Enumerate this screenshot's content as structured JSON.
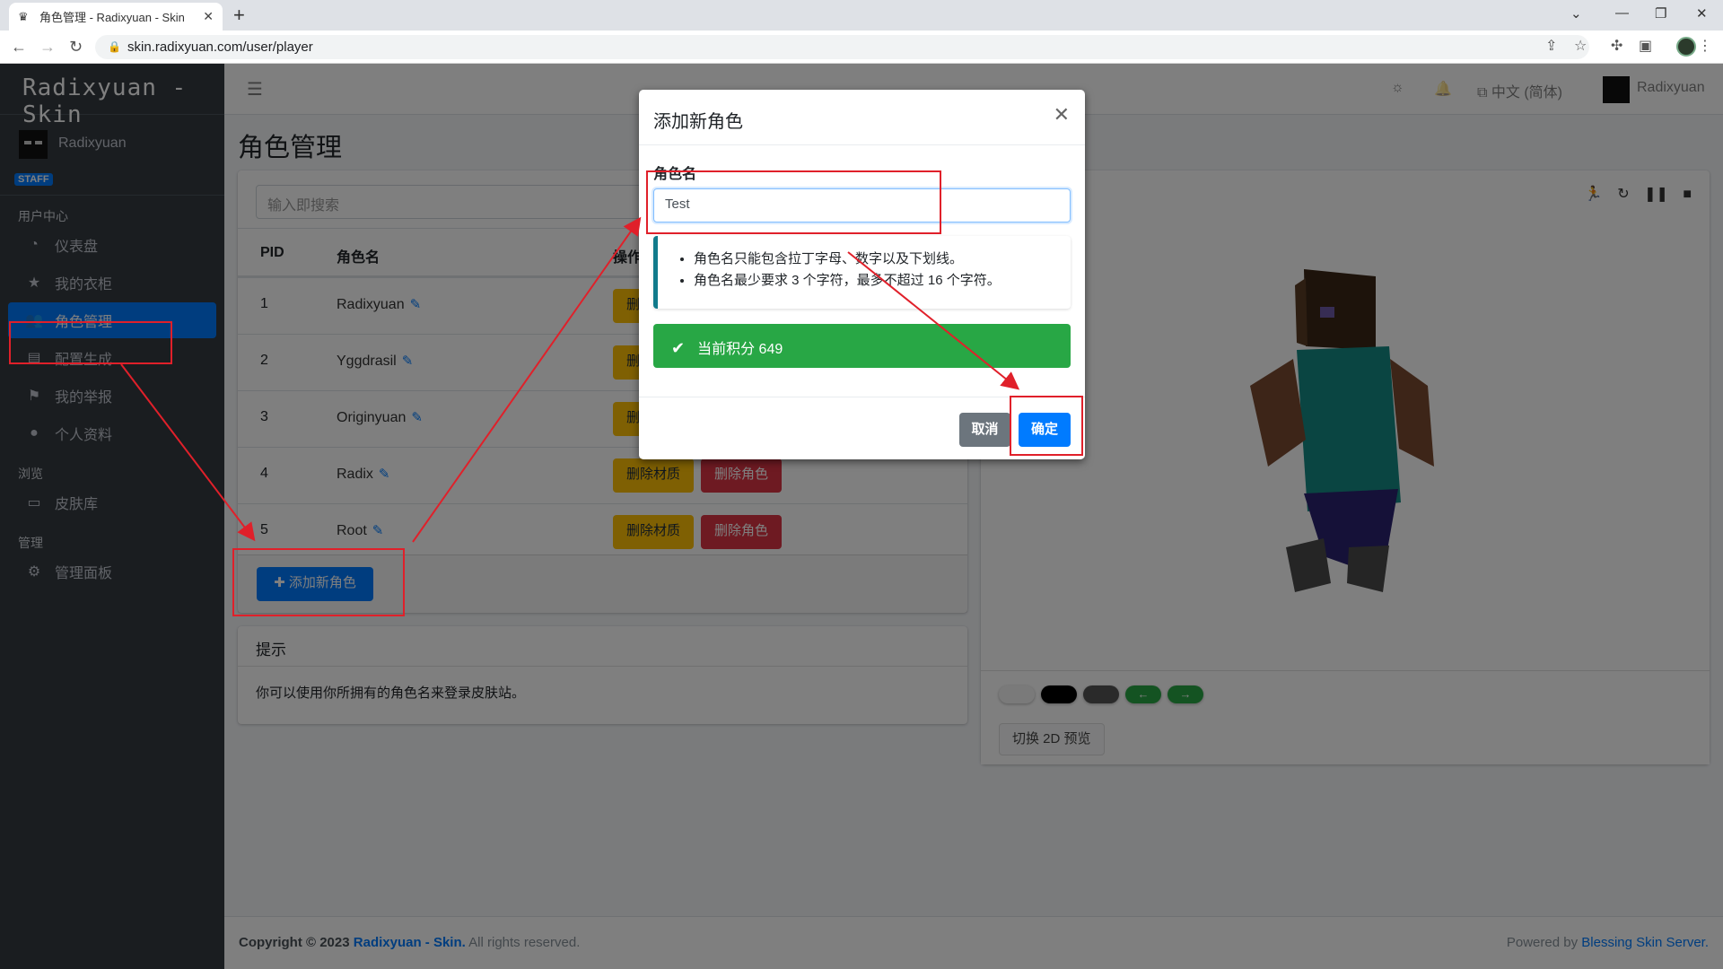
{
  "browser": {
    "tab_title": "角色管理 - Radixyuan - Skin",
    "url": "skin.radixyuan.com/user/player"
  },
  "sidebar": {
    "brand": "Radixyuan - Skin",
    "user_name": "Radixyuan",
    "badge": "STAFF",
    "sections": [
      {
        "header": "用户中心"
      },
      {
        "header": "浏览"
      },
      {
        "header": "管理"
      }
    ],
    "items": [
      {
        "label": "仪表盘",
        "icon": "dashboard-icon"
      },
      {
        "label": "我的衣柜",
        "icon": "star-icon"
      },
      {
        "label": "角色管理",
        "icon": "users-icon",
        "active": true
      },
      {
        "label": "配置生成",
        "icon": "book-icon"
      },
      {
        "label": "我的举报",
        "icon": "flag-icon"
      },
      {
        "label": "个人资料",
        "icon": "user-icon"
      },
      {
        "label": "皮肤库",
        "icon": "archive-icon"
      },
      {
        "label": "管理面板",
        "icon": "gear-icon"
      }
    ]
  },
  "topnav": {
    "language": "中文 (简体)",
    "user_name": "Radixyuan"
  },
  "page_title": "角色管理",
  "players": {
    "search_placeholder": "输入即搜索",
    "columns": [
      "PID",
      "角色名",
      "操作"
    ],
    "rows": [
      {
        "pid": "1",
        "name": "Radixyuan"
      },
      {
        "pid": "2",
        "name": "Yggdrasil"
      },
      {
        "pid": "3",
        "name": "Originyuan"
      },
      {
        "pid": "4",
        "name": "Radix"
      },
      {
        "pid": "5",
        "name": "Root"
      }
    ],
    "delete_texture": "删除材质",
    "delete_player": "删除角色",
    "add_button": "添加新角色"
  },
  "tips": {
    "title": "提示",
    "body": "你可以使用你所拥有的角色名来登录皮肤站。"
  },
  "preview": {
    "toggle_button": "切换 2D 预览"
  },
  "footer": {
    "copyright_prefix": "Copyright © 2023",
    "site": "Radixyuan - Skin.",
    "rights": "All rights reserved.",
    "powered_prefix": "Powered by",
    "powered_link": "Blessing Skin Server."
  },
  "modal": {
    "title": "添加新角色",
    "field_label": "角色名",
    "field_value": "Test",
    "rules": [
      "角色名只能包含拉丁字母、数字以及下划线。",
      "角色名最少要求 3 个字符，最多不超过 16 个字符。"
    ],
    "credit": "当前积分 649",
    "cancel": "取消",
    "confirm": "确定"
  },
  "colors": {
    "primary": "#007bff",
    "success": "#28a745",
    "warning": "#ffc107",
    "danger": "#dc3545",
    "highlight": "#e0202a"
  }
}
